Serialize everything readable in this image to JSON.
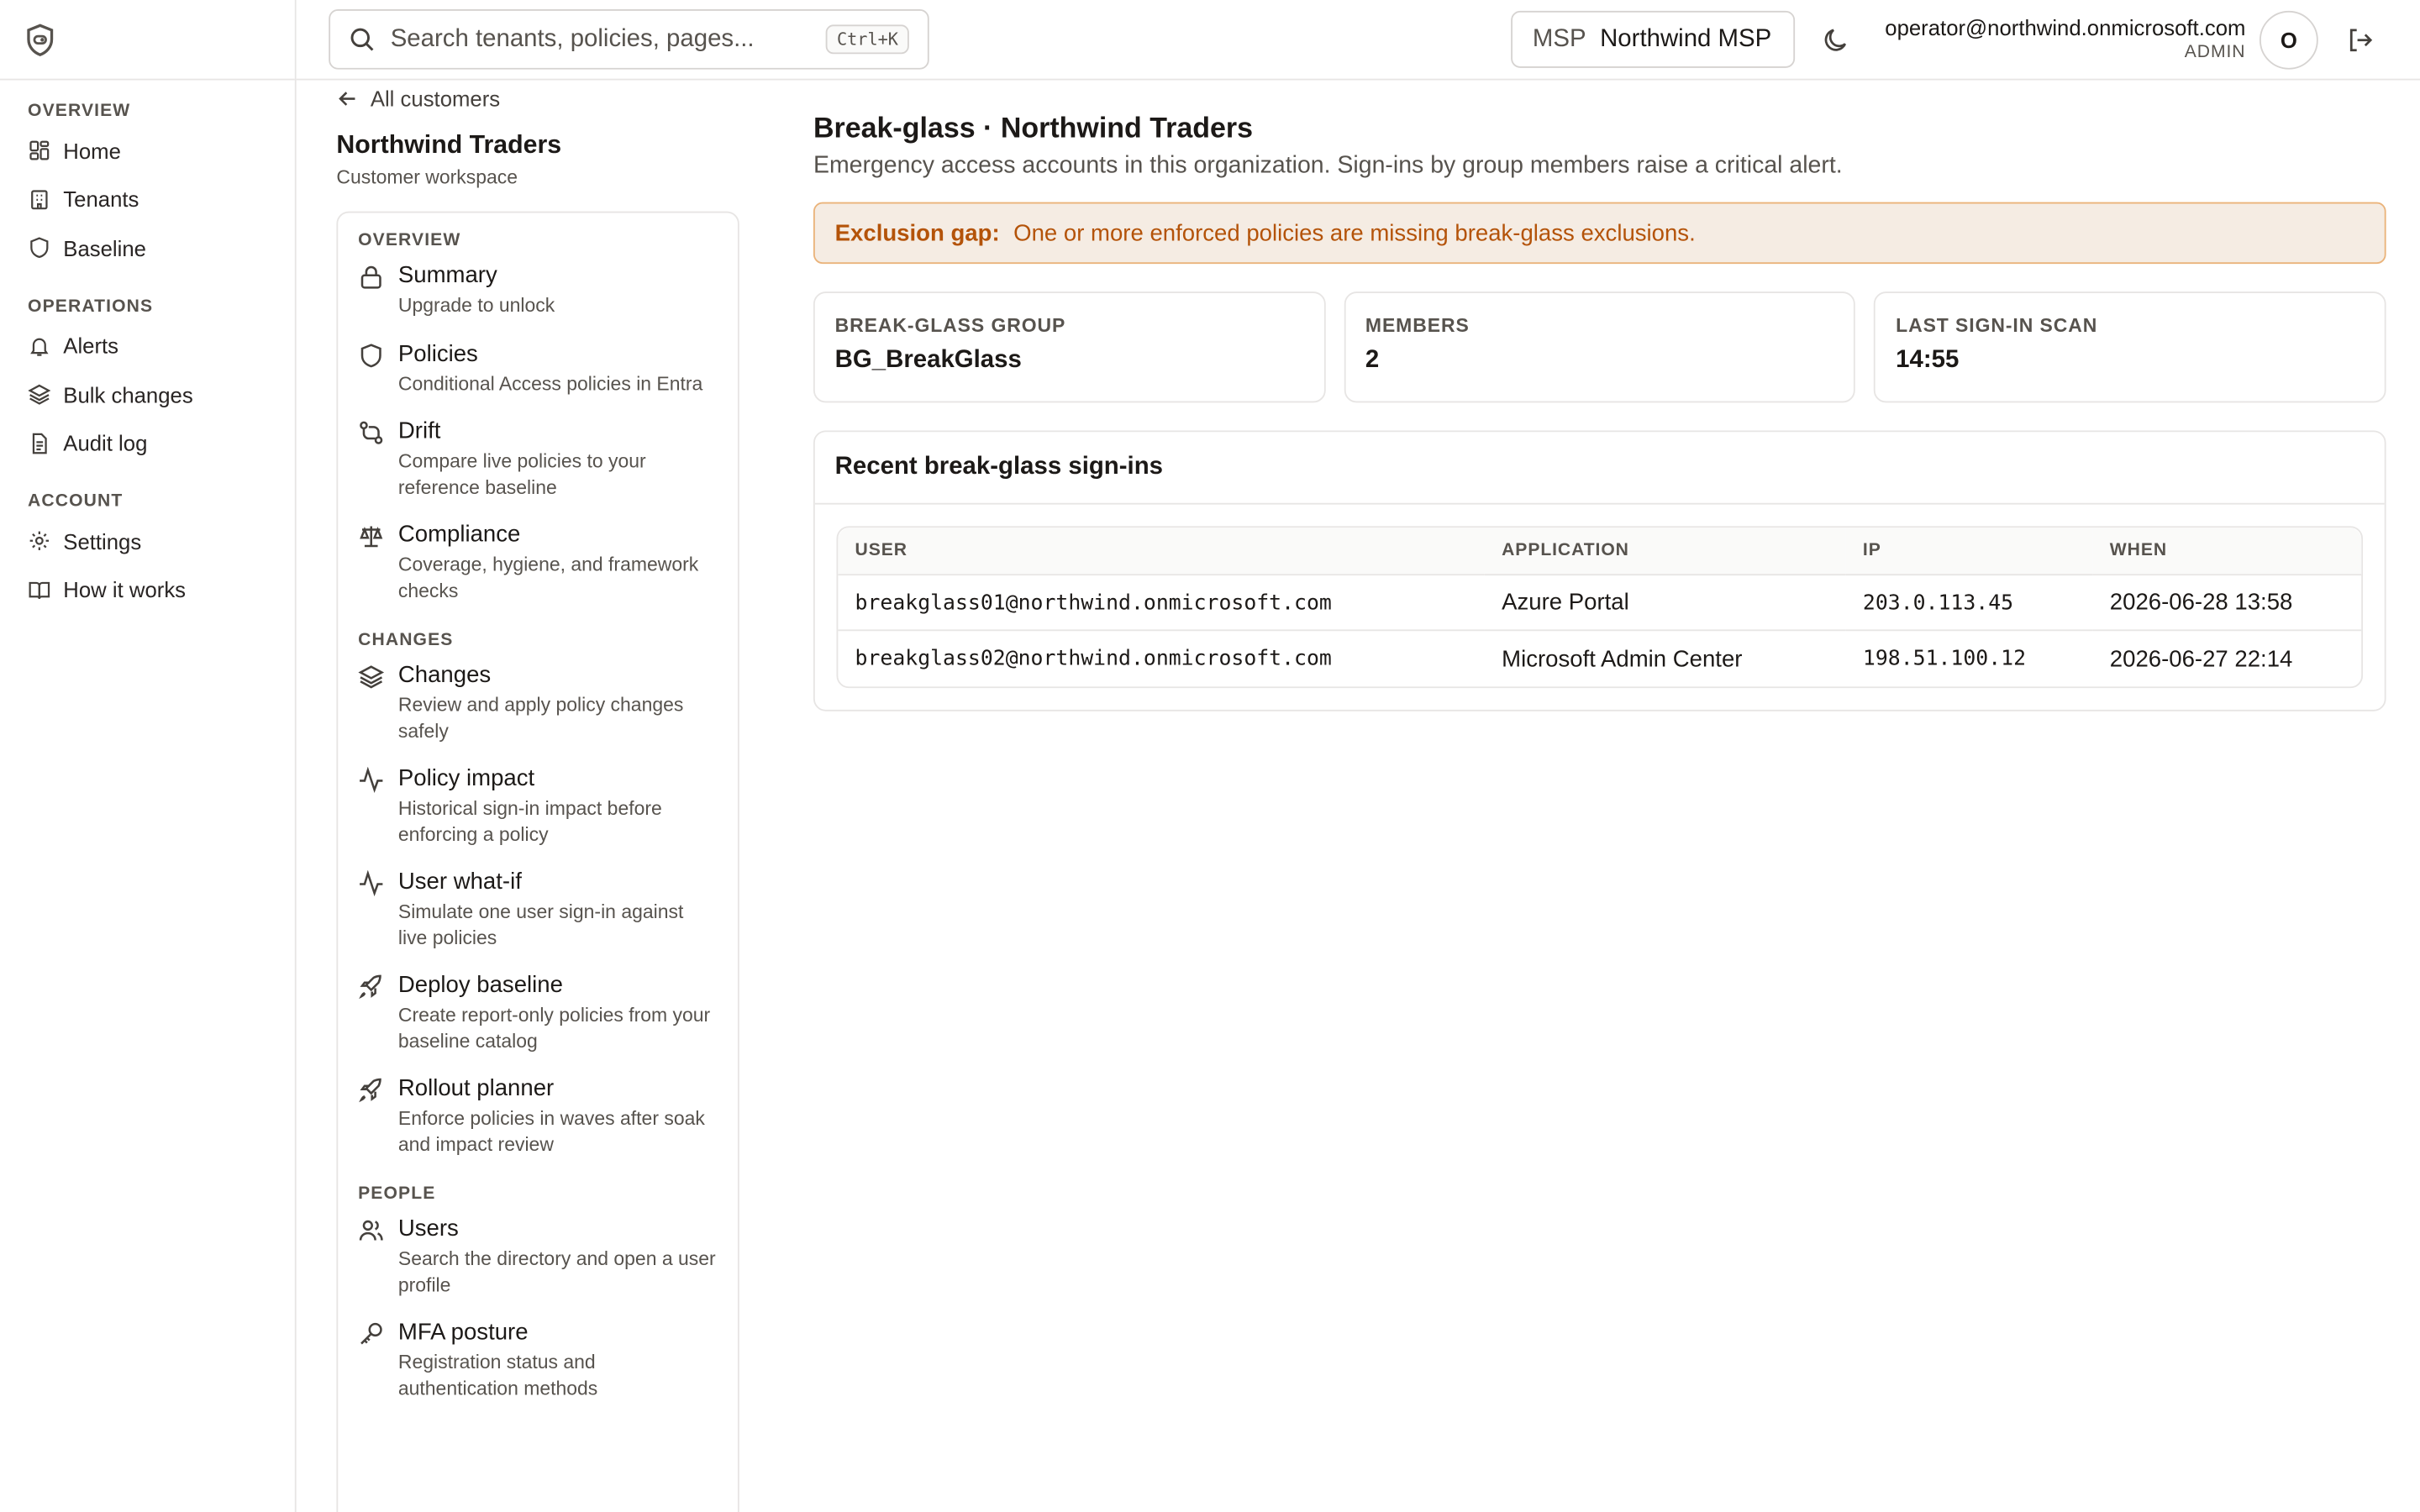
{
  "topbar": {
    "search_placeholder": "Search tenants, policies, pages...",
    "search_shortcut": "Ctrl+K",
    "msp_label": "MSP",
    "msp_name": "Northwind MSP",
    "user_email": "operator@northwind.onmicrosoft.com",
    "user_role": "ADMIN",
    "avatar_initial": "O"
  },
  "sidebar": {
    "sections": [
      {
        "title": "OVERVIEW",
        "items": [
          {
            "label": "Home",
            "icon": "grid-icon"
          },
          {
            "label": "Tenants",
            "icon": "building-icon"
          },
          {
            "label": "Baseline",
            "icon": "shield-icon"
          }
        ]
      },
      {
        "title": "OPERATIONS",
        "items": [
          {
            "label": "Alerts",
            "icon": "bell-icon"
          },
          {
            "label": "Bulk changes",
            "icon": "layers-icon"
          },
          {
            "label": "Audit log",
            "icon": "file-icon"
          }
        ]
      },
      {
        "title": "ACCOUNT",
        "items": [
          {
            "label": "Settings",
            "icon": "gear-icon"
          },
          {
            "label": "How it works",
            "icon": "book-icon"
          }
        ]
      }
    ]
  },
  "customer": {
    "back_label": "All customers",
    "name": "Northwind Traders",
    "subtitle": "Customer workspace"
  },
  "subnav": {
    "sections": [
      {
        "title": "OVERVIEW",
        "items": [
          {
            "title": "Summary",
            "desc": "Upgrade to unlock",
            "icon": "lock-icon"
          },
          {
            "title": "Policies",
            "desc": "Conditional Access policies in Entra",
            "icon": "shield-icon"
          },
          {
            "title": "Drift",
            "desc": "Compare live policies to your reference baseline",
            "icon": "git-compare-icon"
          },
          {
            "title": "Compliance",
            "desc": "Coverage, hygiene, and framework checks",
            "icon": "scale-icon"
          }
        ]
      },
      {
        "title": "CHANGES",
        "items": [
          {
            "title": "Changes",
            "desc": "Review and apply policy changes safely",
            "icon": "layers-icon"
          },
          {
            "title": "Policy impact",
            "desc": "Historical sign-in impact before enforcing a policy",
            "icon": "activity-icon"
          },
          {
            "title": "User what-if",
            "desc": "Simulate one user sign-in against live policies",
            "icon": "activity-icon"
          },
          {
            "title": "Deploy baseline",
            "desc": "Create report-only policies from your baseline catalog",
            "icon": "rocket-icon"
          },
          {
            "title": "Rollout planner",
            "desc": "Enforce policies in waves after soak and impact review",
            "icon": "rocket-icon"
          }
        ]
      },
      {
        "title": "PEOPLE",
        "items": [
          {
            "title": "Users",
            "desc": "Search the directory and open a user profile",
            "icon": "users-icon"
          },
          {
            "title": "MFA posture",
            "desc": "Registration status and authentication methods",
            "icon": "key-icon"
          }
        ]
      }
    ]
  },
  "main": {
    "title": "Break-glass · Northwind Traders",
    "subtitle": "Emergency access accounts in this organization. Sign-ins by group members raise a critical alert.",
    "alert_label": "Exclusion gap:",
    "alert_text": "One or more enforced policies are missing break-glass exclusions.",
    "stats": [
      {
        "label": "BREAK-GLASS GROUP",
        "value": "BG_BreakGlass"
      },
      {
        "label": "MEMBERS",
        "value": "2"
      },
      {
        "label": "LAST SIGN-IN SCAN",
        "value": "14:55"
      }
    ],
    "signins_title": "Recent break-glass sign-ins",
    "columns": [
      "USER",
      "APPLICATION",
      "IP",
      "WHEN"
    ],
    "rows": [
      {
        "user": "breakglass01@northwind.onmicrosoft.com",
        "app": "Azure Portal",
        "ip": "203.0.113.45",
        "when": "2026-06-28 13:58"
      },
      {
        "user": "breakglass02@northwind.onmicrosoft.com",
        "app": "Microsoft Admin Center",
        "ip": "198.51.100.12",
        "when": "2026-06-27 22:14"
      }
    ]
  },
  "colors": {
    "alert_text": "#b45309",
    "alert_bg": "#f5ece3",
    "alert_border": "#eab37a"
  }
}
